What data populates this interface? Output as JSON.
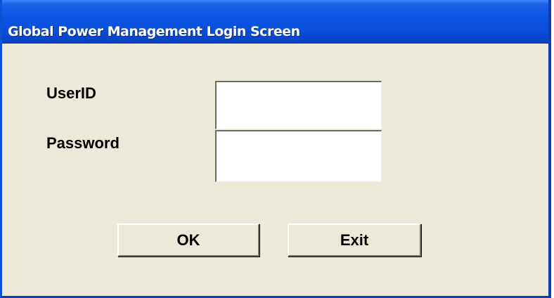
{
  "window": {
    "title": "Global Power Management Login Screen"
  },
  "form": {
    "userid_label": "UserID",
    "userid_value": "",
    "password_label": "Password",
    "password_value": ""
  },
  "buttons": {
    "ok_label": "OK",
    "exit_label": "Exit"
  },
  "colors": {
    "title_bar": "#0a4fd9",
    "window_background": "#ece9d8",
    "title_text": "#ffffff"
  }
}
